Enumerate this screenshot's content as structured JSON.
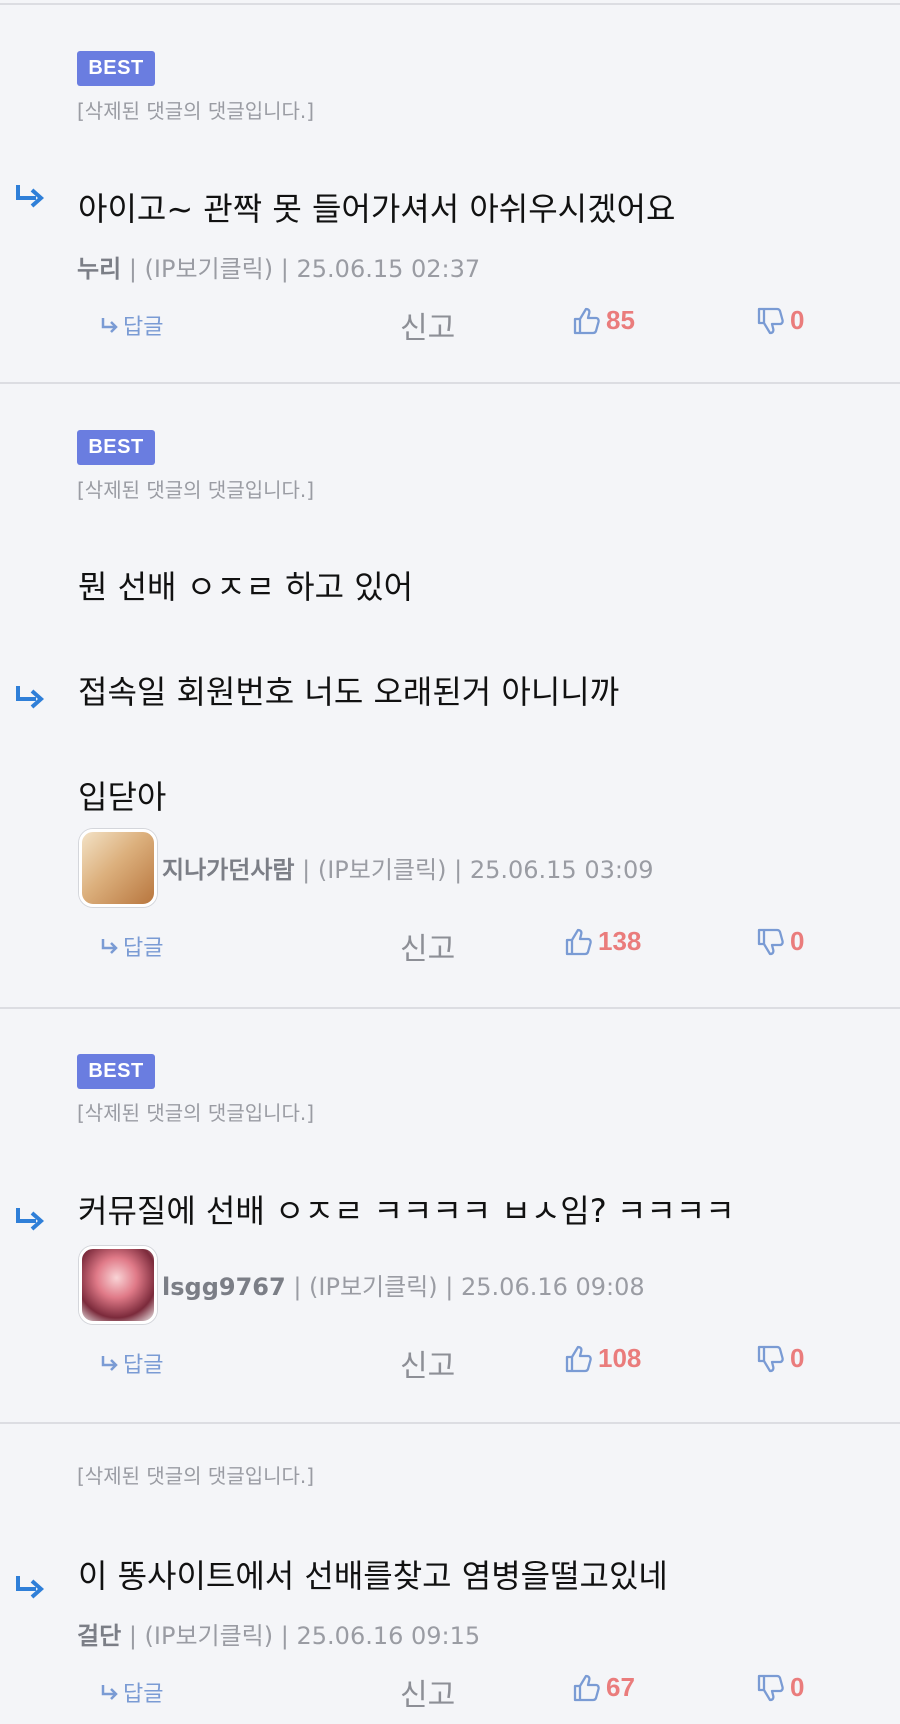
{
  "labels": {
    "best": "BEST",
    "reply": "답글",
    "report": "신고"
  },
  "colors": {
    "best_badge": "#6a7de0",
    "vote_count": "#ea7c7c",
    "reply_link": "#7a9bd4",
    "thread_arrow": "#2f7fd8"
  },
  "comments": [
    {
      "best": true,
      "parent_note": "[삭제된 댓글의 댓글입니다.]",
      "lines": [
        "아이고~ 관짝 못 들어가셔서 아쉬우시겠어요"
      ],
      "author": "누리",
      "ip": "(IP보기클릭)",
      "date": "25.06.15 02:37",
      "likes": "85",
      "dislikes": "0"
    },
    {
      "best": true,
      "parent_note": "[삭제된 댓글의 댓글입니다.]",
      "lines": [
        "뭔 선배 ㅇㅈㄹ 하고 있어",
        "접속일 회원번호 너도 오래된거 아니니까",
        "입닫아"
      ],
      "author": "지나가던사람",
      "ip": "(IP보기클릭)",
      "date": "25.06.15 03:09",
      "avatar_icon": "avatar-anime-character",
      "likes": "138",
      "dislikes": "0"
    },
    {
      "best": true,
      "parent_note": "[삭제된 댓글의 댓글입니다.]",
      "lines": [
        "커뮤질에 선배 ㅇㅈㄹ ㅋㅋㅋㅋ ㅂㅅ임? ㅋㅋㅋㅋ"
      ],
      "author": "lsgg9767",
      "ip": "(IP보기클릭)",
      "date": "25.06.16 09:08",
      "avatar_icon": "avatar-anime-character",
      "likes": "108",
      "dislikes": "0"
    },
    {
      "best": false,
      "parent_note": "[삭제된 댓글의 댓글입니다.]",
      "lines": [
        "이 똥사이트에서 선배를찾고 염병을떨고있네"
      ],
      "author": "걸단",
      "ip": "(IP보기클릭)",
      "date": "25.06.16 09:15",
      "likes": "67",
      "dislikes": "0"
    }
  ]
}
